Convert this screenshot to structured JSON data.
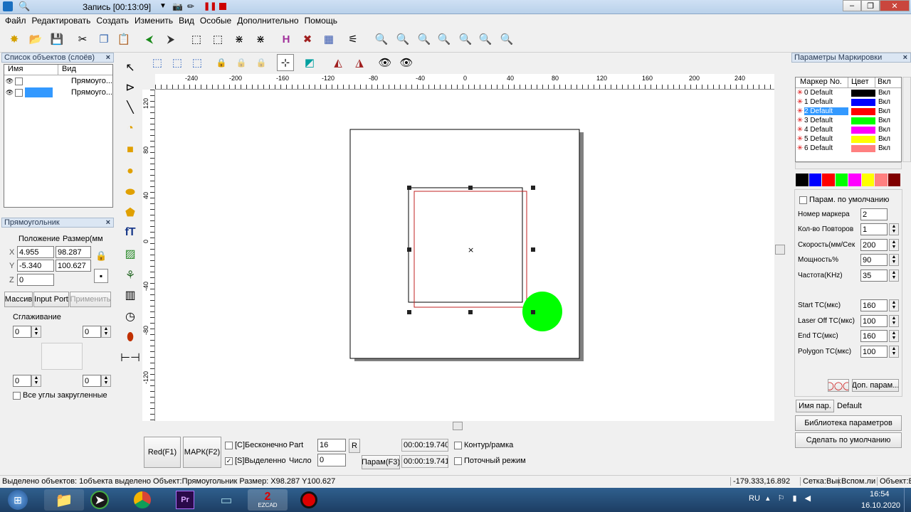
{
  "window": {
    "title": "Запись [00:13:09]"
  },
  "menu": [
    "Файл",
    "Редактировать",
    "Создать",
    "Изменить",
    "Вид",
    "Особые",
    "Дополнительно",
    "Помощь"
  ],
  "objects_panel": {
    "title": "Список объектов (слоёв)",
    "col_name": "Имя",
    "col_view": "Вид",
    "rows": [
      "Прямоуго...",
      "Прямоуго..."
    ]
  },
  "props_panel": {
    "title": "Прямоугольник",
    "position_label": "Положение",
    "size_label": "Размер(мм",
    "x_label": "X",
    "y_label": "Y",
    "z_label": "Z",
    "x": "4.955",
    "y": "-5.340",
    "z": "0",
    "w": "98.287",
    "h": "100.627",
    "btn_array": "Массив",
    "btn_input_port": "Input Port",
    "btn_apply": "Применить",
    "smoothing_label": "Сглаживание",
    "spin1": "0",
    "spin2": "0",
    "spin3": "0",
    "spin4": "0",
    "round_corners": "Все углы закругленные"
  },
  "ruler": {
    "h_ticks": [
      "-240",
      "-200",
      "-160",
      "-120",
      "-80",
      "-40",
      "0",
      "40",
      "80",
      "120",
      "160",
      "200",
      "240"
    ],
    "v_ticks": [
      "120",
      "80",
      "40",
      "0",
      "-40",
      "-80",
      "-120"
    ]
  },
  "bottom_controls": {
    "red_btn": "Red(F1)",
    "mark_btn": "MАРК(F2)",
    "infinite": "[C]Бесконечно",
    "selected": "[S]Выделенно",
    "part_label": "Part",
    "part_value": "16",
    "r_btn": "R",
    "count_label": "Число",
    "count_value": "0",
    "param_btn": "Парам(F3)",
    "time1": "00:00:19.740",
    "time2": "00:00:19.741",
    "contour": "Контур/рамка",
    "stream": "Поточный режим"
  },
  "marking_params": {
    "title": "Параметры Маркировки",
    "col_marker": "Маркер No.",
    "col_color": "Цвет",
    "col_on": "Вкл",
    "markers": [
      {
        "name": "0 Default",
        "color": "#000000",
        "on": "Вкл"
      },
      {
        "name": "1 Default",
        "color": "#0000ff",
        "on": "Вкл"
      },
      {
        "name": "2 Default",
        "color": "#ff0000",
        "on": "Вкл"
      },
      {
        "name": "3 Default",
        "color": "#00ff00",
        "on": "Вкл"
      },
      {
        "name": "4 Default",
        "color": "#ff00ff",
        "on": "Вкл"
      },
      {
        "name": "5 Default",
        "color": "#ffff00",
        "on": "Вкл"
      },
      {
        "name": "6 Default",
        "color": "#ff8080",
        "on": "Вкл"
      }
    ],
    "palette": [
      "#000000",
      "#0000ff",
      "#ff0000",
      "#00ff00",
      "#ff00ff",
      "#ffff00",
      "#ff8080",
      "#800000"
    ],
    "default_param": "Парам. по умолчанию",
    "fields": [
      {
        "label": "Номер маркера",
        "value": "2"
      },
      {
        "label": "Кол-во Повторов",
        "value": "1"
      },
      {
        "label": "Скорость(мм/Сек",
        "value": "200"
      },
      {
        "label": "Мощность%",
        "value": "90"
      },
      {
        "label": "Частота(KHz)",
        "value": "35"
      },
      {
        "label": "Start TC(мкс)",
        "value": "160"
      },
      {
        "label": "Laser Off TC(мкс)",
        "value": "100"
      },
      {
        "label": "End TC(мкс)",
        "value": "160"
      },
      {
        "label": "Polygon TC(мкс)",
        "value": "100"
      }
    ],
    "extra_btn": "Доп. парам...",
    "param_name_label": "Имя пар.",
    "param_name_value": "Default",
    "library_btn": "Библиотека параметров",
    "make_default_btn": "Сделать по умолчанию"
  },
  "status": {
    "left": "Выделено объектов: 1объекта выделено Объект:Прямоугольник Размер: X98.287 Y100.627",
    "coords": "-179.333,16.892",
    "grid": "Сетка:Вык",
    "aux": "Вспом.ли",
    "obj": "Объект:В"
  },
  "tray": {
    "lang": "RU",
    "time": "16:54",
    "date": "16.10.2020"
  },
  "taskbar_apps": [
    "start",
    "explorer",
    "app-arrow",
    "chrome",
    "premiere",
    "folder",
    "ezcad",
    "record"
  ],
  "ezcad_label": "EZCAD"
}
